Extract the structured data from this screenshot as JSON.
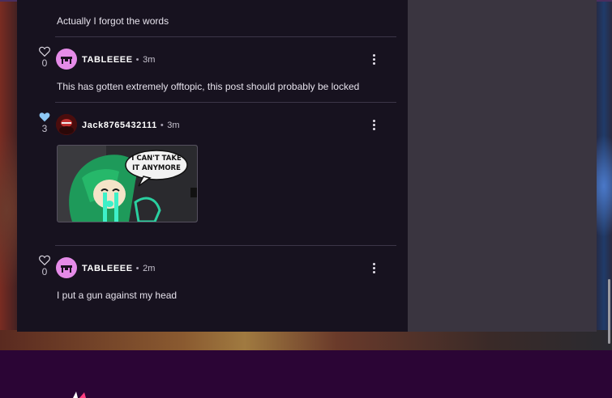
{
  "comments": [
    {
      "text": "Actually I forgot the words"
    },
    {
      "likes": "0",
      "liked": false,
      "username": "TABLEEEE",
      "time": "3m",
      "text": "This has gotten extremely offtopic, this post should probably be locked"
    },
    {
      "likes": "3",
      "liked": true,
      "username": "Jack8765432111",
      "time": "3m",
      "image": {
        "caption": "I CAN'T TAKE IT ANYMORE"
      }
    },
    {
      "likes": "0",
      "liked": false,
      "username": "TABLEEEE",
      "time": "2m",
      "text": "I put a gun against my head"
    }
  ],
  "separator": "•",
  "icons": {
    "like": "heart-icon",
    "liked": "heart-filled-icon",
    "more": "kebab-menu-icon"
  },
  "colors": {
    "feed_bg": "#17121f",
    "side_panel": "#3a3540",
    "footer": "#2b0535",
    "liked_heart": "#8ec8f5",
    "avatar_pink": "#e58be8"
  }
}
